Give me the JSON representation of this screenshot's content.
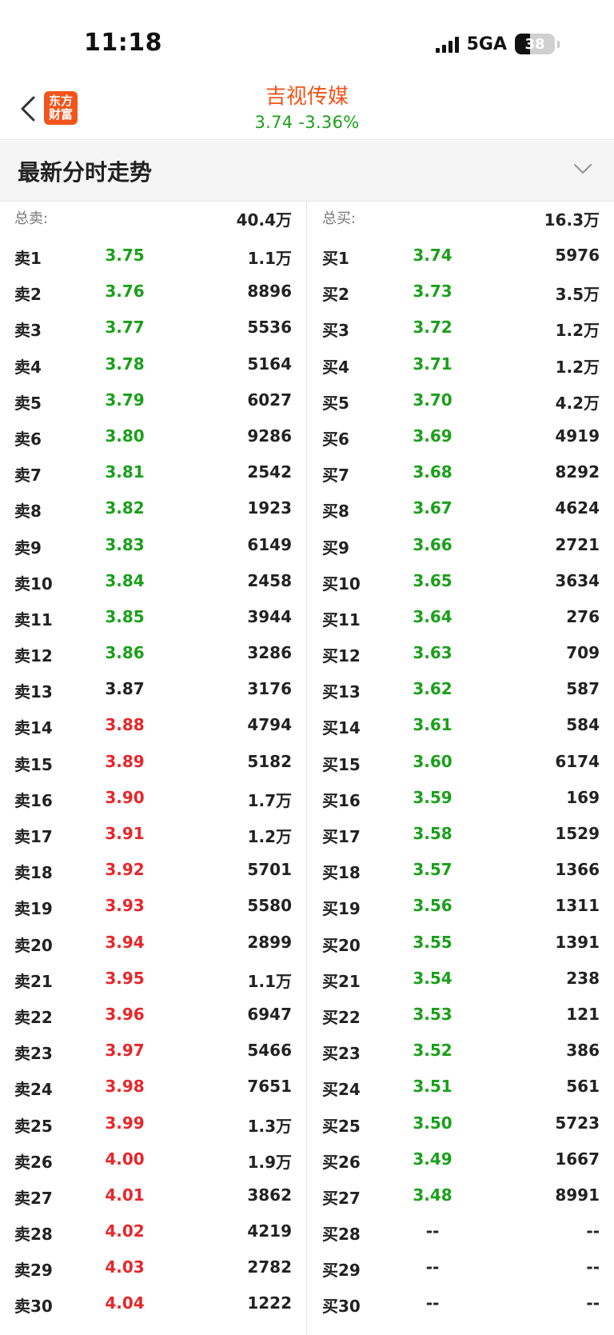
{
  "status": {
    "time": "11:18",
    "network": "5GA",
    "battery": "38"
  },
  "header": {
    "stock_name": "吉视传媒",
    "quote": "3.74  -3.36%",
    "logo_line1": "东方",
    "logo_line2": "财富"
  },
  "section": {
    "title": "最新分时走势"
  },
  "colors": {
    "up": "#e8262a",
    "down": "#1aa01a",
    "brand": "#f2541b"
  },
  "sell": {
    "total_label": "总卖:",
    "total_value": "40.4万",
    "rows": [
      {
        "level": "卖1",
        "price": "3.75",
        "volume": "1.1万",
        "color": "green"
      },
      {
        "level": "卖2",
        "price": "3.76",
        "volume": "8896",
        "color": "green"
      },
      {
        "level": "卖3",
        "price": "3.77",
        "volume": "5536",
        "color": "green"
      },
      {
        "level": "卖4",
        "price": "3.78",
        "volume": "5164",
        "color": "green"
      },
      {
        "level": "卖5",
        "price": "3.79",
        "volume": "6027",
        "color": "green"
      },
      {
        "level": "卖6",
        "price": "3.80",
        "volume": "9286",
        "color": "green"
      },
      {
        "level": "卖7",
        "price": "3.81",
        "volume": "2542",
        "color": "green"
      },
      {
        "level": "卖8",
        "price": "3.82",
        "volume": "1923",
        "color": "green"
      },
      {
        "level": "卖9",
        "price": "3.83",
        "volume": "6149",
        "color": "green"
      },
      {
        "level": "卖10",
        "price": "3.84",
        "volume": "2458",
        "color": "green"
      },
      {
        "level": "卖11",
        "price": "3.85",
        "volume": "3944",
        "color": "green"
      },
      {
        "level": "卖12",
        "price": "3.86",
        "volume": "3286",
        "color": "green"
      },
      {
        "level": "卖13",
        "price": "3.87",
        "volume": "3176",
        "color": "neutral"
      },
      {
        "level": "卖14",
        "price": "3.88",
        "volume": "4794",
        "color": "red"
      },
      {
        "level": "卖15",
        "price": "3.89",
        "volume": "5182",
        "color": "red"
      },
      {
        "level": "卖16",
        "price": "3.90",
        "volume": "1.7万",
        "color": "red"
      },
      {
        "level": "卖17",
        "price": "3.91",
        "volume": "1.2万",
        "color": "red"
      },
      {
        "level": "卖18",
        "price": "3.92",
        "volume": "5701",
        "color": "red"
      },
      {
        "level": "卖19",
        "price": "3.93",
        "volume": "5580",
        "color": "red"
      },
      {
        "level": "卖20",
        "price": "3.94",
        "volume": "2899",
        "color": "red"
      },
      {
        "level": "卖21",
        "price": "3.95",
        "volume": "1.1万",
        "color": "red"
      },
      {
        "level": "卖22",
        "price": "3.96",
        "volume": "6947",
        "color": "red"
      },
      {
        "level": "卖23",
        "price": "3.97",
        "volume": "5466",
        "color": "red"
      },
      {
        "level": "卖24",
        "price": "3.98",
        "volume": "7651",
        "color": "red"
      },
      {
        "level": "卖25",
        "price": "3.99",
        "volume": "1.3万",
        "color": "red"
      },
      {
        "level": "卖26",
        "price": "4.00",
        "volume": "1.9万",
        "color": "red"
      },
      {
        "level": "卖27",
        "price": "4.01",
        "volume": "3862",
        "color": "red"
      },
      {
        "level": "卖28",
        "price": "4.02",
        "volume": "4219",
        "color": "red"
      },
      {
        "level": "卖29",
        "price": "4.03",
        "volume": "2782",
        "color": "red"
      },
      {
        "level": "卖30",
        "price": "4.04",
        "volume": "1222",
        "color": "red"
      }
    ]
  },
  "buy": {
    "total_label": "总买:",
    "total_value": "16.3万",
    "rows": [
      {
        "level": "买1",
        "price": "3.74",
        "volume": "5976",
        "color": "green"
      },
      {
        "level": "买2",
        "price": "3.73",
        "volume": "3.5万",
        "color": "green"
      },
      {
        "level": "买3",
        "price": "3.72",
        "volume": "1.2万",
        "color": "green"
      },
      {
        "level": "买4",
        "price": "3.71",
        "volume": "1.2万",
        "color": "green"
      },
      {
        "level": "买5",
        "price": "3.70",
        "volume": "4.2万",
        "color": "green"
      },
      {
        "level": "买6",
        "price": "3.69",
        "volume": "4919",
        "color": "green"
      },
      {
        "level": "买7",
        "price": "3.68",
        "volume": "8292",
        "color": "green"
      },
      {
        "level": "买8",
        "price": "3.67",
        "volume": "4624",
        "color": "green"
      },
      {
        "level": "买9",
        "price": "3.66",
        "volume": "2721",
        "color": "green"
      },
      {
        "level": "买10",
        "price": "3.65",
        "volume": "3634",
        "color": "green"
      },
      {
        "level": "买11",
        "price": "3.64",
        "volume": "276",
        "color": "green"
      },
      {
        "level": "买12",
        "price": "3.63",
        "volume": "709",
        "color": "green"
      },
      {
        "level": "买13",
        "price": "3.62",
        "volume": "587",
        "color": "green"
      },
      {
        "level": "买14",
        "price": "3.61",
        "volume": "584",
        "color": "green"
      },
      {
        "level": "买15",
        "price": "3.60",
        "volume": "6174",
        "color": "green"
      },
      {
        "level": "买16",
        "price": "3.59",
        "volume": "169",
        "color": "green"
      },
      {
        "level": "买17",
        "price": "3.58",
        "volume": "1529",
        "color": "green"
      },
      {
        "level": "买18",
        "price": "3.57",
        "volume": "1366",
        "color": "green"
      },
      {
        "level": "买19",
        "price": "3.56",
        "volume": "1311",
        "color": "green"
      },
      {
        "level": "买20",
        "price": "3.55",
        "volume": "1391",
        "color": "green"
      },
      {
        "level": "买21",
        "price": "3.54",
        "volume": "238",
        "color": "green"
      },
      {
        "level": "买22",
        "price": "3.53",
        "volume": "121",
        "color": "green"
      },
      {
        "level": "买23",
        "price": "3.52",
        "volume": "386",
        "color": "green"
      },
      {
        "level": "买24",
        "price": "3.51",
        "volume": "561",
        "color": "green"
      },
      {
        "level": "买25",
        "price": "3.50",
        "volume": "5723",
        "color": "green"
      },
      {
        "level": "买26",
        "price": "3.49",
        "volume": "1667",
        "color": "green"
      },
      {
        "level": "买27",
        "price": "3.48",
        "volume": "8991",
        "color": "green"
      },
      {
        "level": "买28",
        "price": "--",
        "volume": "--",
        "color": "neutral"
      },
      {
        "level": "买29",
        "price": "--",
        "volume": "--",
        "color": "neutral"
      },
      {
        "level": "买30",
        "price": "--",
        "volume": "--",
        "color": "neutral"
      }
    ]
  }
}
